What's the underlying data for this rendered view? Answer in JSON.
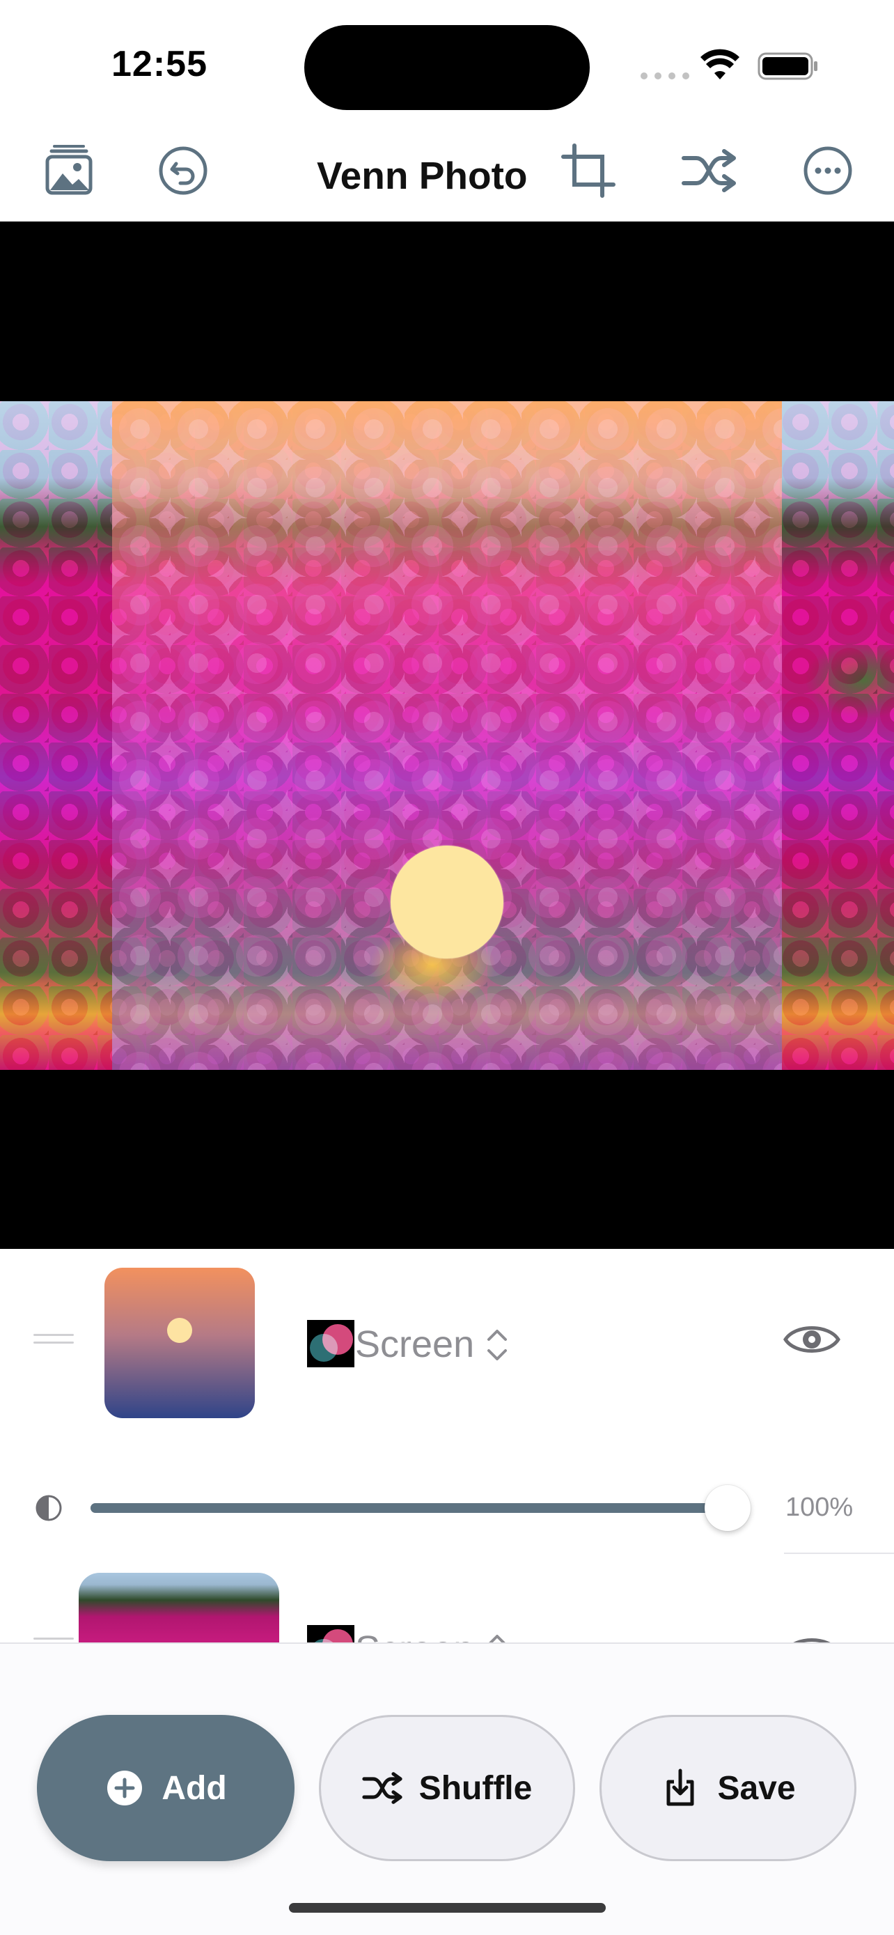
{
  "status_bar": {
    "time": "12:55"
  },
  "toolbar": {
    "title": "Venn Photo",
    "icons": [
      "photo-library-icon",
      "undo-icon",
      "crop-icon",
      "shuffle-icon",
      "more-icon"
    ]
  },
  "layers": [
    {
      "blend_mode": "Screen",
      "opacity": "100%",
      "opacity_fraction": 1.0,
      "visible": true
    },
    {
      "blend_mode": "Screen",
      "visible": true
    }
  ],
  "actions": {
    "add_label": "Add",
    "shuffle_label": "Shuffle",
    "save_label": "Save"
  },
  "colors": {
    "accent": "#5e7482",
    "slider_fill": "#5d7281",
    "secondary_text": "#8e8e93"
  }
}
